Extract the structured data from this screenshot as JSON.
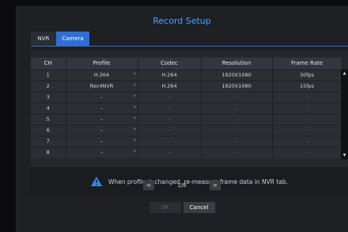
{
  "title": "Record Setup",
  "tabs": [
    {
      "label": "NVR",
      "active": false
    },
    {
      "label": "Camera",
      "active": true
    }
  ],
  "table": {
    "headers": [
      "CH",
      "Profile",
      "Codec",
      "Resolution",
      "Frame Rate"
    ],
    "rows": [
      {
        "ch": "1",
        "profile": "H.264",
        "codec": "H.264",
        "resolution": "1920X1080",
        "frame_rate": "30fps"
      },
      {
        "ch": "2",
        "profile": "Rec4NVR",
        "codec": "H.264",
        "resolution": "1920X1080",
        "frame_rate": "15fps"
      },
      {
        "ch": "3",
        "profile": "–",
        "codec": "–",
        "resolution": "–",
        "frame_rate": "–"
      },
      {
        "ch": "4",
        "profile": "–",
        "codec": "–",
        "resolution": "–",
        "frame_rate": "–"
      },
      {
        "ch": "5",
        "profile": "–",
        "codec": "–",
        "resolution": "–",
        "frame_rate": "–"
      },
      {
        "ch": "6",
        "profile": "–",
        "codec": "–",
        "resolution": "–",
        "frame_rate": "–"
      },
      {
        "ch": "7",
        "profile": "–",
        "codec": "–",
        "resolution": "–",
        "frame_rate": "–"
      },
      {
        "ch": "8",
        "profile": "–",
        "codec": "–",
        "resolution": "–",
        "frame_rate": "–"
      }
    ]
  },
  "notice": {
    "icon": "warning-icon",
    "text": "When profile is changed, re-measure frame data in NVR tab."
  },
  "pager": {
    "prev_icon": "chevron-left-icon",
    "next_icon": "chevron-right-icon",
    "prev_glyph": "<",
    "next_glyph": ">",
    "label": "1/8"
  },
  "footer": {
    "ok_label": "OK",
    "cancel_label": "Cancel"
  },
  "scroll": {
    "up_glyph": "▲",
    "down_glyph": "▼"
  },
  "colors": {
    "accent": "#2e6fd6",
    "title": "#4aa3ff",
    "warning": "#2e8cf0"
  }
}
